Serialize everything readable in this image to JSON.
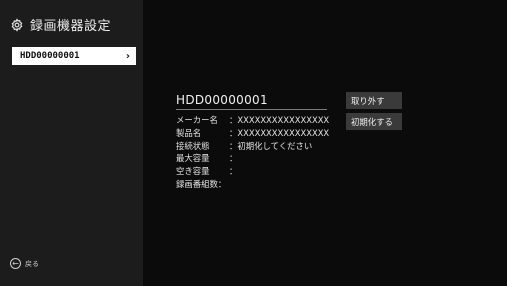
{
  "header": {
    "title": "録画機器設定",
    "icon": "gear-icon"
  },
  "sidebar": {
    "device_item": {
      "label": "HDD00000001",
      "chevron": "›"
    },
    "back": {
      "label": "戻る",
      "icon": "back-arrow-icon"
    }
  },
  "detail": {
    "device_name": "HDD00000001",
    "rows": [
      {
        "label": "メーカー名",
        "sep": "：",
        "value": "XXXXXXXXXXXXXXXX"
      },
      {
        "label": "製品名",
        "sep": "：",
        "value": "XXXXXXXXXXXXXXXX"
      },
      {
        "label": "接続状態",
        "sep": "：",
        "value": "初期化してください"
      },
      {
        "label": "最大容量",
        "sep": "：",
        "value": ""
      },
      {
        "label": "空き容量",
        "sep": "：",
        "value": ""
      },
      {
        "label": "録画番組数",
        "sep": "：",
        "value": ""
      }
    ]
  },
  "actions": {
    "remove_label": "取り外す",
    "initialize_label": "初期化する"
  },
  "colors": {
    "sidebar_bg": "#1c1c1c",
    "main_bg": "#0b0b0b",
    "selected_item_bg": "#ffffff",
    "button_bg": "#3a3a3a"
  }
}
